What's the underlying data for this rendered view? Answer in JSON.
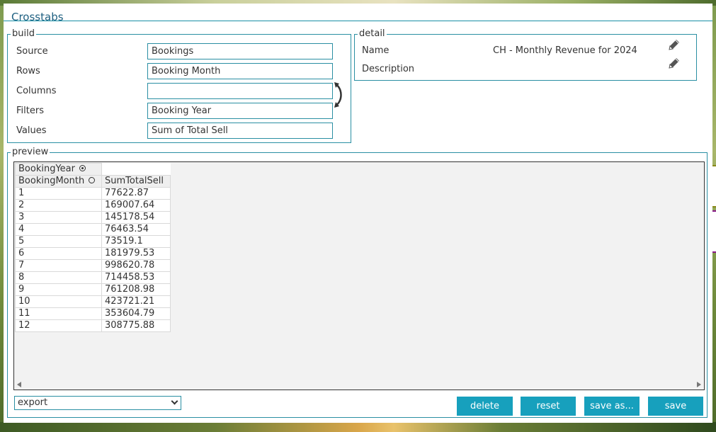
{
  "window": {
    "title": "Crosstabs"
  },
  "build": {
    "legend": "build",
    "source_label": "Source",
    "source_value": "Bookings",
    "rows_label": "Rows",
    "rows_value": "Booking Month",
    "columns_label": "Columns",
    "columns_value": "",
    "filters_label": "Filters",
    "filters_value": "Booking Year",
    "values_label": "Values",
    "values_value": "Sum of Total Sell"
  },
  "detail": {
    "legend": "detail",
    "name_label": "Name",
    "name_value": "CH - Monthly Revenue for 2024",
    "description_label": "Description",
    "description_value": ""
  },
  "preview": {
    "legend": "preview",
    "filter_header": "BookingYear",
    "row_header": "BookingMonth",
    "value_header": "SumTotalSell",
    "rows": [
      {
        "month": "1",
        "value": "77622.87"
      },
      {
        "month": "2",
        "value": "169007.64"
      },
      {
        "month": "3",
        "value": "145178.54"
      },
      {
        "month": "4",
        "value": "76463.54"
      },
      {
        "month": "5",
        "value": "73519.1"
      },
      {
        "month": "6",
        "value": "181979.53"
      },
      {
        "month": "7",
        "value": "998620.78"
      },
      {
        "month": "8",
        "value": "714458.53"
      },
      {
        "month": "9",
        "value": "761208.98"
      },
      {
        "month": "10",
        "value": "423721.21"
      },
      {
        "month": "11",
        "value": "353604.79"
      },
      {
        "month": "12",
        "value": "308775.88"
      }
    ]
  },
  "footer": {
    "export_select_value": "export",
    "delete_label": "delete",
    "reset_label": "reset",
    "save_as_label": "save as...",
    "save_label": "save"
  },
  "colors": {
    "accent": "#17a0bd",
    "border": "#2a8fa3",
    "title": "#1d5f80",
    "side_tab_1": "#8a8a1a",
    "side_tab_2": "#8a1a8a"
  },
  "icons": [
    "swap-arrows-icon",
    "pencil-icon",
    "radio-icon",
    "scroll-left-icon",
    "scroll-right-icon",
    "chevron-down-icon"
  ]
}
